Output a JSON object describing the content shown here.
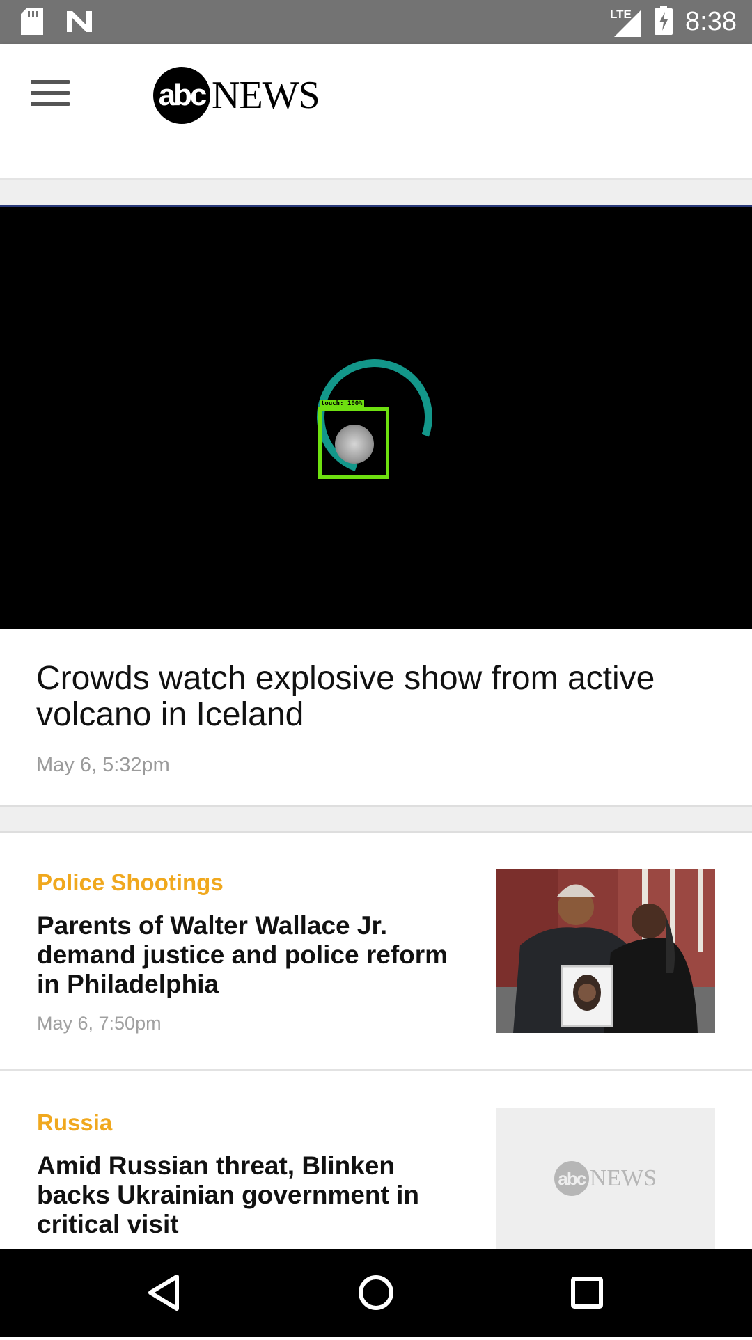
{
  "status_bar": {
    "network": "LTE",
    "time": "8:38",
    "bg_color": "#737373"
  },
  "header": {
    "logo_circle_text": "abc",
    "logo_word": "NEWS"
  },
  "video": {
    "touch_label": "touch: 100%",
    "spinner_color": "#13978a",
    "touch_box_color": "#6ee010"
  },
  "feature": {
    "title": "Crowds watch explosive show from active volcano in Iceland",
    "timestamp": "May 6, 5:32pm"
  },
  "stories": [
    {
      "kicker": "Police Shootings",
      "headline": "Parents of Walter Wallace Jr. demand justice and police reform in Philadelphia",
      "timestamp": "May 6, 7:50pm"
    },
    {
      "kicker": "Russia",
      "headline": "Amid Russian threat, Blinken backs Ukrainian government in critical visit",
      "placeholder_circle_text": "abc",
      "placeholder_word": "NEWS"
    }
  ],
  "colors": {
    "kicker": "#f0a81e",
    "nav_bar": "#000000"
  }
}
